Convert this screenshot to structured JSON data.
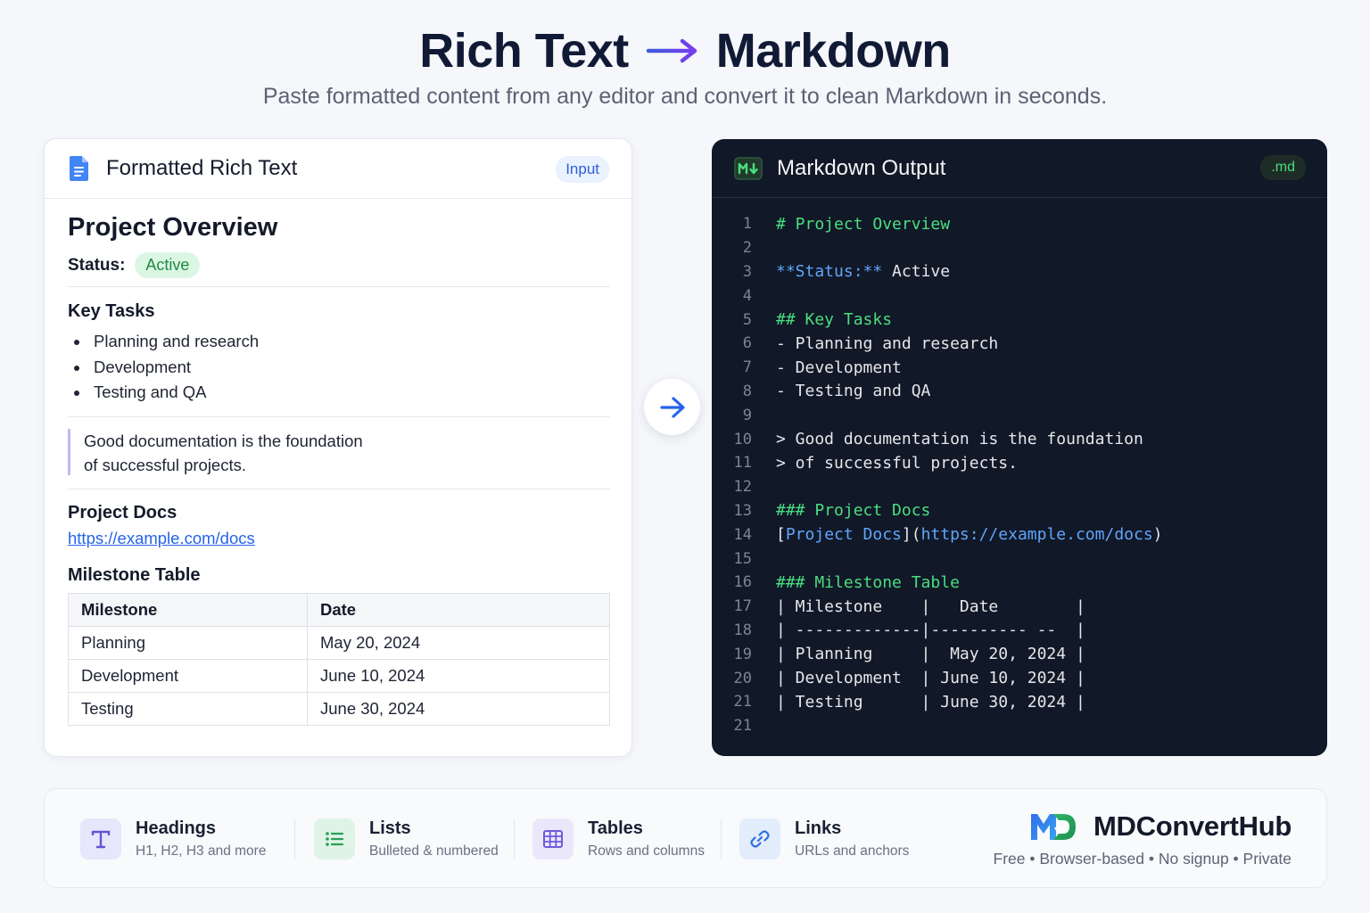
{
  "header": {
    "title_left": "Rich Text",
    "title_right": "Markdown",
    "subtitle": "Paste formatted content from any editor and convert it to clean Markdown in seconds."
  },
  "input_panel": {
    "title": "Formatted Rich Text",
    "badge": "Input",
    "doc_title": "Project Overview",
    "status_label": "Status:",
    "status_value": "Active",
    "tasks_heading": "Key Tasks",
    "tasks": [
      "Planning and research",
      "Development",
      "Testing and QA"
    ],
    "quote_lines": [
      "Good documentation is the foundation",
      "of successful projects."
    ],
    "docs_heading": "Project Docs",
    "docs_link": "https://example.com/docs",
    "table_heading": "Milestone Table",
    "table_headers": [
      "Milestone",
      "Date"
    ],
    "table_rows": [
      [
        "Planning",
        "May 20, 2024"
      ],
      [
        "Development",
        "June 10, 2024"
      ],
      [
        "Testing",
        "June 30, 2024"
      ]
    ]
  },
  "output_panel": {
    "title": "Markdown Output",
    "badge": ".md",
    "lines": [
      {
        "n": "1",
        "parts": [
          {
            "t": "# Project Overview",
            "c": "green"
          }
        ]
      },
      {
        "n": "2",
        "parts": []
      },
      {
        "n": "3",
        "parts": [
          {
            "t": "**Status:**",
            "c": "blue"
          },
          {
            "t": " Active",
            "c": "white"
          }
        ]
      },
      {
        "n": "4",
        "parts": []
      },
      {
        "n": "5",
        "parts": [
          {
            "t": "## Key Tasks",
            "c": "green"
          }
        ]
      },
      {
        "n": "6",
        "parts": [
          {
            "t": "- Planning and research",
            "c": "white"
          }
        ]
      },
      {
        "n": "7",
        "parts": [
          {
            "t": "- Development",
            "c": "white"
          }
        ]
      },
      {
        "n": "8",
        "parts": [
          {
            "t": "- Testing and QA",
            "c": "white"
          }
        ]
      },
      {
        "n": "9",
        "parts": []
      },
      {
        "n": "10",
        "parts": [
          {
            "t": "> Good documentation is the foundation",
            "c": "white"
          }
        ]
      },
      {
        "n": "11",
        "parts": [
          {
            "t": "> of successful projects.",
            "c": "white"
          }
        ]
      },
      {
        "n": "12",
        "parts": []
      },
      {
        "n": "13",
        "parts": [
          {
            "t": "### Project Docs",
            "c": "green"
          }
        ]
      },
      {
        "n": "14",
        "parts": [
          {
            "t": "[",
            "c": "white"
          },
          {
            "t": "Project Docs",
            "c": "blue"
          },
          {
            "t": "](",
            "c": "white"
          },
          {
            "t": "https://example.com/docs",
            "c": "blue"
          },
          {
            "t": ")",
            "c": "white"
          }
        ]
      },
      {
        "n": "15",
        "parts": []
      },
      {
        "n": "16",
        "parts": [
          {
            "t": "### Milestone Table",
            "c": "green"
          }
        ]
      },
      {
        "n": "17",
        "parts": [
          {
            "t": "| Milestone    |   Date        |",
            "c": "white"
          }
        ]
      },
      {
        "n": "18",
        "parts": [
          {
            "t": "| -------------|---------- --  |",
            "c": "white"
          }
        ]
      },
      {
        "n": "19",
        "parts": [
          {
            "t": "| Planning     |  May 20, 2024 |",
            "c": "white"
          }
        ]
      },
      {
        "n": "20",
        "parts": [
          {
            "t": "| Development  | June 10, 2024 |",
            "c": "white"
          }
        ]
      },
      {
        "n": "21",
        "parts": [
          {
            "t": "| Testing      | June 30, 2024 |",
            "c": "white"
          }
        ]
      },
      {
        "n": "21",
        "parts": []
      }
    ]
  },
  "features": [
    {
      "title": "Headings",
      "subtitle": "H1, H2, H3 and more",
      "icon": "heading-icon"
    },
    {
      "title": "Lists",
      "subtitle": "Bulleted & numbered",
      "icon": "list-icon"
    },
    {
      "title": "Tables",
      "subtitle": "Rows and columns",
      "icon": "table-icon"
    },
    {
      "title": "Links",
      "subtitle": "URLs and anchors",
      "icon": "link-icon"
    }
  ],
  "brand": {
    "name": "MDConvertHub",
    "tagline": "Free • Browser-based • No signup • Private"
  },
  "colors": {
    "accent": "#4f46e5",
    "link": "#2563eb",
    "code_bg": "#111827",
    "md_green": "#4ade80",
    "md_blue": "#60a5fa"
  }
}
